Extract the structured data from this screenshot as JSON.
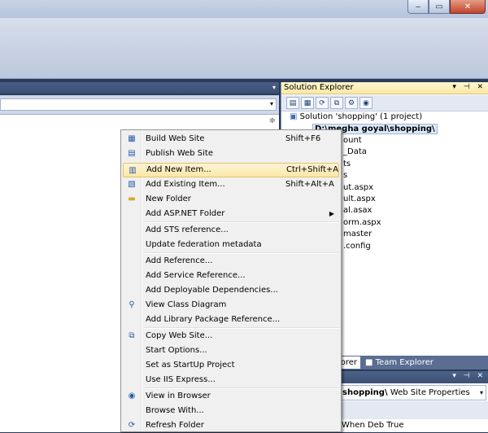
{
  "window": {
    "controls": {
      "minimize": "‒",
      "maximize": "▭",
      "close": "✕"
    }
  },
  "solution_explorer": {
    "title": "Solution Explorer",
    "controls": "▾ ⊣ ✕",
    "tree": [
      {
        "text": "Solution 'shopping' (1 project)"
      },
      {
        "text": "D:\\megha goyal\\shopping\\",
        "selected": true
      },
      {
        "text": "ount"
      },
      {
        "text": "_Data"
      },
      {
        "text": "ts"
      },
      {
        "text": "s"
      },
      {
        "text": "ut.aspx"
      },
      {
        "text": "ult.aspx"
      },
      {
        "text": "al.asax"
      },
      {
        "text": "orm.aspx"
      },
      {
        "text": "master"
      },
      {
        "text": ".config"
      }
    ],
    "tabs": {
      "solution_explorer": "lorer",
      "team_explorer": "Team Explorer"
    }
  },
  "properties": {
    "controls": "▾ ⊣ ✕",
    "combo_project": "shopping\\",
    "combo_type": "Web Site Properties",
    "row_name": "When Deb",
    "row_value": "True"
  },
  "context_menu": {
    "items": [
      {
        "label": "Build Web Site",
        "shortcut": "Shift+F6",
        "icon": "build-icon"
      },
      {
        "label": "Publish Web Site",
        "shortcut": "",
        "icon": "publish-icon"
      },
      {
        "label": "Add New Item...",
        "shortcut": "Ctrl+Shift+A",
        "icon": "new-item-icon",
        "highlighted": true
      },
      {
        "label": "Add Existing Item...",
        "shortcut": "Shift+Alt+A",
        "icon": "existing-item-icon"
      },
      {
        "label": "New Folder",
        "shortcut": "",
        "icon": "folder-icon"
      },
      {
        "label": "Add ASP.NET Folder",
        "shortcut": "",
        "submenu": true
      },
      {
        "label": "Add STS reference...",
        "shortcut": ""
      },
      {
        "label": "Update federation metadata",
        "shortcut": ""
      },
      {
        "label": "Add Reference...",
        "shortcut": ""
      },
      {
        "label": "Add Service Reference...",
        "shortcut": ""
      },
      {
        "label": "Add Deployable Dependencies...",
        "shortcut": ""
      },
      {
        "label": "View Class Diagram",
        "shortcut": "",
        "icon": "class-diagram-icon"
      },
      {
        "label": "Add Library Package Reference...",
        "shortcut": ""
      },
      {
        "label": "Copy Web Site...",
        "shortcut": "",
        "icon": "copy-web-icon"
      },
      {
        "label": "Start Options...",
        "shortcut": ""
      },
      {
        "label": "Set as StartUp Project",
        "shortcut": ""
      },
      {
        "label": "Use IIS Express...",
        "shortcut": ""
      },
      {
        "label": "View in Browser",
        "shortcut": "",
        "icon": "browser-icon"
      },
      {
        "label": "Browse With...",
        "shortcut": ""
      },
      {
        "label": "Refresh Folder",
        "shortcut": "",
        "icon": "refresh-icon"
      }
    ]
  }
}
